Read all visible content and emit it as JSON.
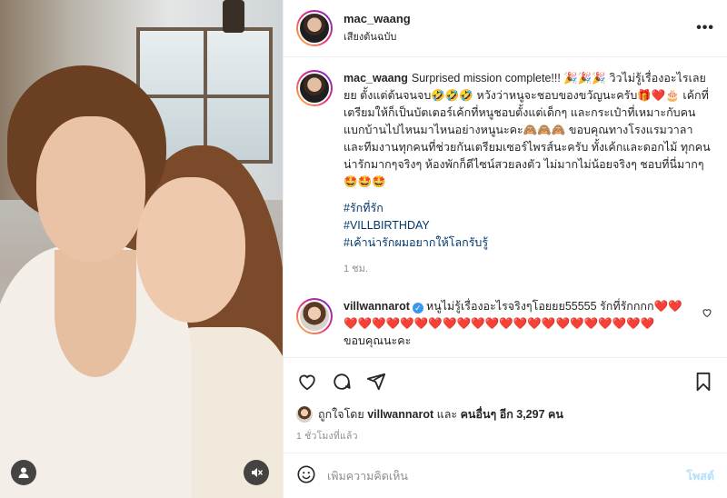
{
  "post": {
    "username": "mac_waang",
    "audio": "เสียงต้นฉบับ",
    "more": "•••",
    "caption": {
      "username": "mac_waang",
      "text": "Surprised mission complete!!! 🎉🎉🎉 วิวไม่รู้เรื่องอะไรเลยยย ตั้งแต่ต้นจนจบ🤣🤣🤣 หวังว่าหนูจะชอบของขวัญนะครับ🎁❤️🎂 เค้กที่เตรียมให้ก็เป็นบัตเตอร์เค้กที่หนูชอบตั้งแต่เด็กๆ และกระเป๋าที่เหมาะกับคนแบกบ้านไปไหนมาไหนอย่างหนูนะคะ🙈🙈🙈 ขอบคุณทางโรงแรมวาลาและทีมงานทุกคนที่ช่วยกันเตรียมเซอร์ไพรส์นะครับ ทั้งเค้กและดอกไม้ ทุกคนน่ารักมากๆจริงๆ ห้องพักก็ดีไซน์สวยลงตัว ไม่มากไม่น้อยจริงๆ ชอบที่นี่มากๆ🤩🤩🤩",
      "hashtags": [
        "#รักที่รัก",
        "#VILLBIRTHDAY",
        "#เค้าน่ารักผมอยากให้โลกรับรู้"
      ],
      "time": "1 ชม."
    },
    "comment": {
      "username": "villwannarot",
      "verified": "✓",
      "text": "หนูไม่รู้เรื่องอะไรจริงๆโอยยย55555 รักที่รักกกก❤️❤️❤️❤️❤️❤️❤️❤️❤️❤️❤️❤️❤️❤️❤️❤️❤️❤️❤️❤️❤️❤️❤️❤️ ขอบคุณนะคะ"
    },
    "likes": {
      "prefix": "ถูกใจโดย",
      "first_user": "villwannarot",
      "middle": "และ",
      "others": "คนอื่นๆ อีก 3,297 คน"
    },
    "ago": "1 ชั่วโมงที่แล้ว",
    "add_comment": {
      "placeholder": "เพิ่มความคิดเห็น",
      "post_label": "โพสต์"
    }
  },
  "icons": {
    "like": "heart-outline-icon",
    "comment": "comment-bubble-icon",
    "share": "paper-plane-icon",
    "save": "bookmark-icon",
    "emoji": "smiley-icon",
    "tagged_users": "user-tag-icon",
    "mute": "speaker-muted-icon"
  },
  "colors": {
    "link": "#00376b",
    "verified": "#3897f0",
    "post_disabled": "#b2dffc",
    "muted_text": "#8e8e8e"
  }
}
